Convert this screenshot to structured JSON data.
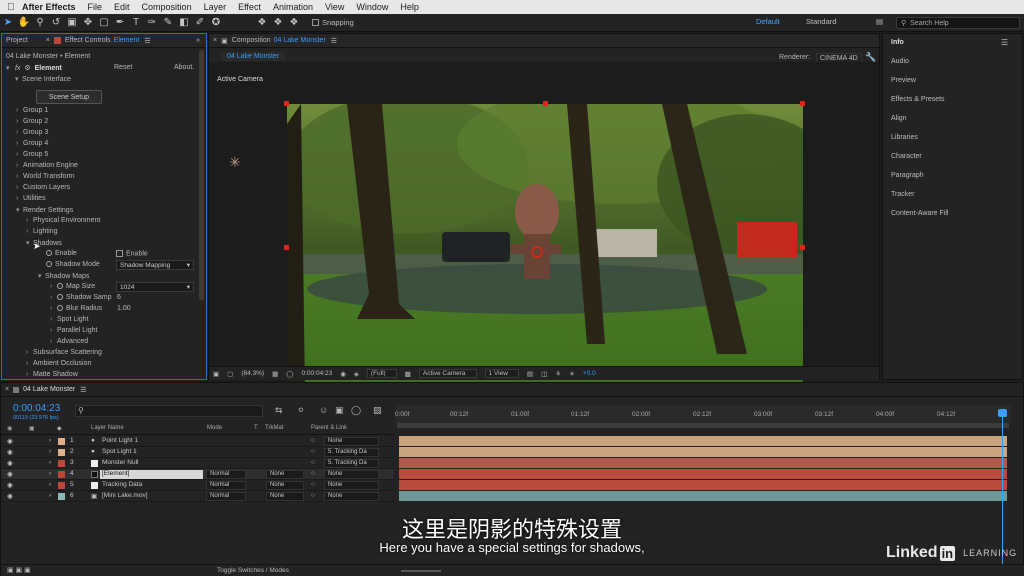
{
  "menubar": {
    "app": "After Effects",
    "menus": [
      "File",
      "Edit",
      "Composition",
      "Layer",
      "Effect",
      "Animation",
      "View",
      "Window",
      "Help"
    ]
  },
  "toolbar": {
    "snapping": "Snapping",
    "workspace_default": "Default",
    "workspace_standard": "Standard",
    "search_placeholder": "Search Help"
  },
  "effect_panel": {
    "tab_project": "Project",
    "tab_effect_controls": "Effect Controls",
    "tab_effect_name": "Element",
    "layer_path": "04 Lake Monster • Element",
    "effect_name": "Element",
    "reset": "Reset",
    "about": "About.",
    "scene_interface": "Scene Interface",
    "scene_setup": "Scene Setup",
    "groups": [
      "Group 1",
      "Group 2",
      "Group 3",
      "Group 4",
      "Group 5"
    ],
    "sections": [
      "Animation Engine",
      "World Transform",
      "Custom Layers",
      "Utilities"
    ],
    "render_settings": "Render Settings",
    "physical_environment": "Physical Environment",
    "lighting": "Lighting",
    "shadows": "Shadows",
    "enable_label": "Enable",
    "enable_checkbox": "Enable",
    "shadow_mode_label": "Shadow Mode",
    "shadow_mode_value": "Shadow Mapping",
    "shadow_maps": "Shadow Maps",
    "map_size_label": "Map Size",
    "map_size_value": "1024",
    "shadow_samp_label": "Shadow Samp",
    "shadow_samp_value": "6",
    "blur_radius_label": "Blur Radius",
    "blur_radius_value": "1.00",
    "spot_light": "Spot Light",
    "parallel_light": "Parallel Light",
    "advanced": "Advanced",
    "subsurface": "Subsurface Scattering",
    "ambient_occlusion": "Ambient Occlusion",
    "matte_shadow": "Matte Shadow"
  },
  "comp_panel": {
    "tab_label": "Composition",
    "tab_name": "04 Lake Monster",
    "sub_tab": "04 Lake Monster",
    "renderer_label": "Renderer:",
    "renderer_value": "CINEMA 4D",
    "active_camera": "Active Camera",
    "bar": {
      "zoom": "(84.3%)",
      "timecode": "0:00:04:23",
      "resolution": "(Full)",
      "camera": "Active Camera",
      "view": "1 View",
      "exposure": "+0.0"
    }
  },
  "right_panel": {
    "items": [
      "Info",
      "Audio",
      "Preview",
      "Effects & Presets",
      "Align",
      "Libraries",
      "Character",
      "Paragraph",
      "Tracker",
      "Content-Aware Fill"
    ]
  },
  "timeline": {
    "tab": "04 Lake Monster",
    "timecode": "0:00:04:23",
    "frames": "00119 (23.976 fps)",
    "col_layer_name": "Layer Name",
    "col_mode": "Mode",
    "col_t": "T",
    "col_trkmat": "TrkMat",
    "col_parent": "Parent & Link",
    "ruler": [
      "0:00f",
      "00:12f",
      "01:00f",
      "01:12f",
      "02:00f",
      "02:12f",
      "03:00f",
      "03:12f",
      "04:00f",
      "04:12f"
    ],
    "layers": [
      {
        "num": "1",
        "name": "Point Light 1",
        "mode": "",
        "trkmat": "",
        "parent": "None",
        "color": "#e0b08a",
        "bar": "#c9a47e"
      },
      {
        "num": "2",
        "name": "Spot Light 1",
        "mode": "",
        "trkmat": "",
        "parent": "5. Tracking Da",
        "color": "#e0b08a",
        "bar": "#c9a47e"
      },
      {
        "num": "3",
        "name": "Monster Null",
        "mode": "",
        "trkmat": "",
        "parent": "5. Tracking Da",
        "color": "#c0453a",
        "bar": "#b45a4d"
      },
      {
        "num": "4",
        "name": "[Element]",
        "mode": "Normal",
        "trkmat": "None",
        "parent": "None",
        "color": "#c0453a",
        "bar": "#b84a3e"
      },
      {
        "num": "5",
        "name": "Tracking Data",
        "mode": "Normal",
        "trkmat": "None",
        "parent": "None",
        "color": "#c0453a",
        "bar": "#b84a3e"
      },
      {
        "num": "6",
        "name": "[Mini Lake.mov]",
        "mode": "Normal",
        "trkmat": "None",
        "parent": "None",
        "color": "#8fb7b8",
        "bar": "#6f9898"
      }
    ],
    "footer": "Toggle Switches / Modes"
  },
  "subtitles": {
    "zh": "这里是阴影的特殊设置",
    "en": "Here you have a special settings for shadows,"
  },
  "logo": {
    "linked": "Linked",
    "in": "in",
    "learning": "LEARNING"
  }
}
